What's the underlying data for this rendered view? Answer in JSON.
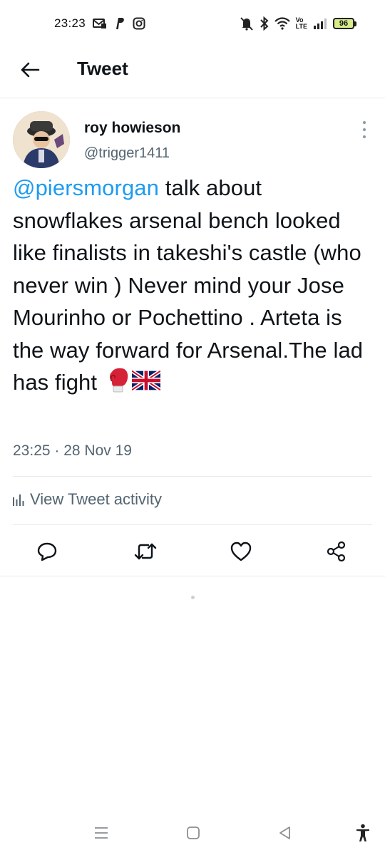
{
  "status_bar": {
    "time": "23:23",
    "battery": "96",
    "volte_top": "Vo",
    "volte_bottom": "LTE"
  },
  "header": {
    "title": "Tweet"
  },
  "tweet": {
    "author_name": "roy howieson",
    "author_handle": "@trigger1411",
    "mention": "@piersmorgan",
    "text": " talk about snowflakes arsenal bench looked like finalists in takeshi's castle (who never win ) Never mind your Jose Mourinho or Pochettino . Arteta is the way forward for Arsenal.The lad has fight",
    "emojis": [
      "boxing-glove",
      "union-jack-flag"
    ],
    "timestamp": "23:25 · 28 Nov 19",
    "activity_label": "View Tweet activity"
  },
  "actions": [
    "reply",
    "retweet",
    "like",
    "share"
  ],
  "colors": {
    "accent": "#1d9bf0",
    "secondary_text": "#536471",
    "primary_text": "#0f1419",
    "divider": "#e7e9ea"
  },
  "nav": [
    "recent-apps",
    "home",
    "back",
    "accessibility"
  ]
}
